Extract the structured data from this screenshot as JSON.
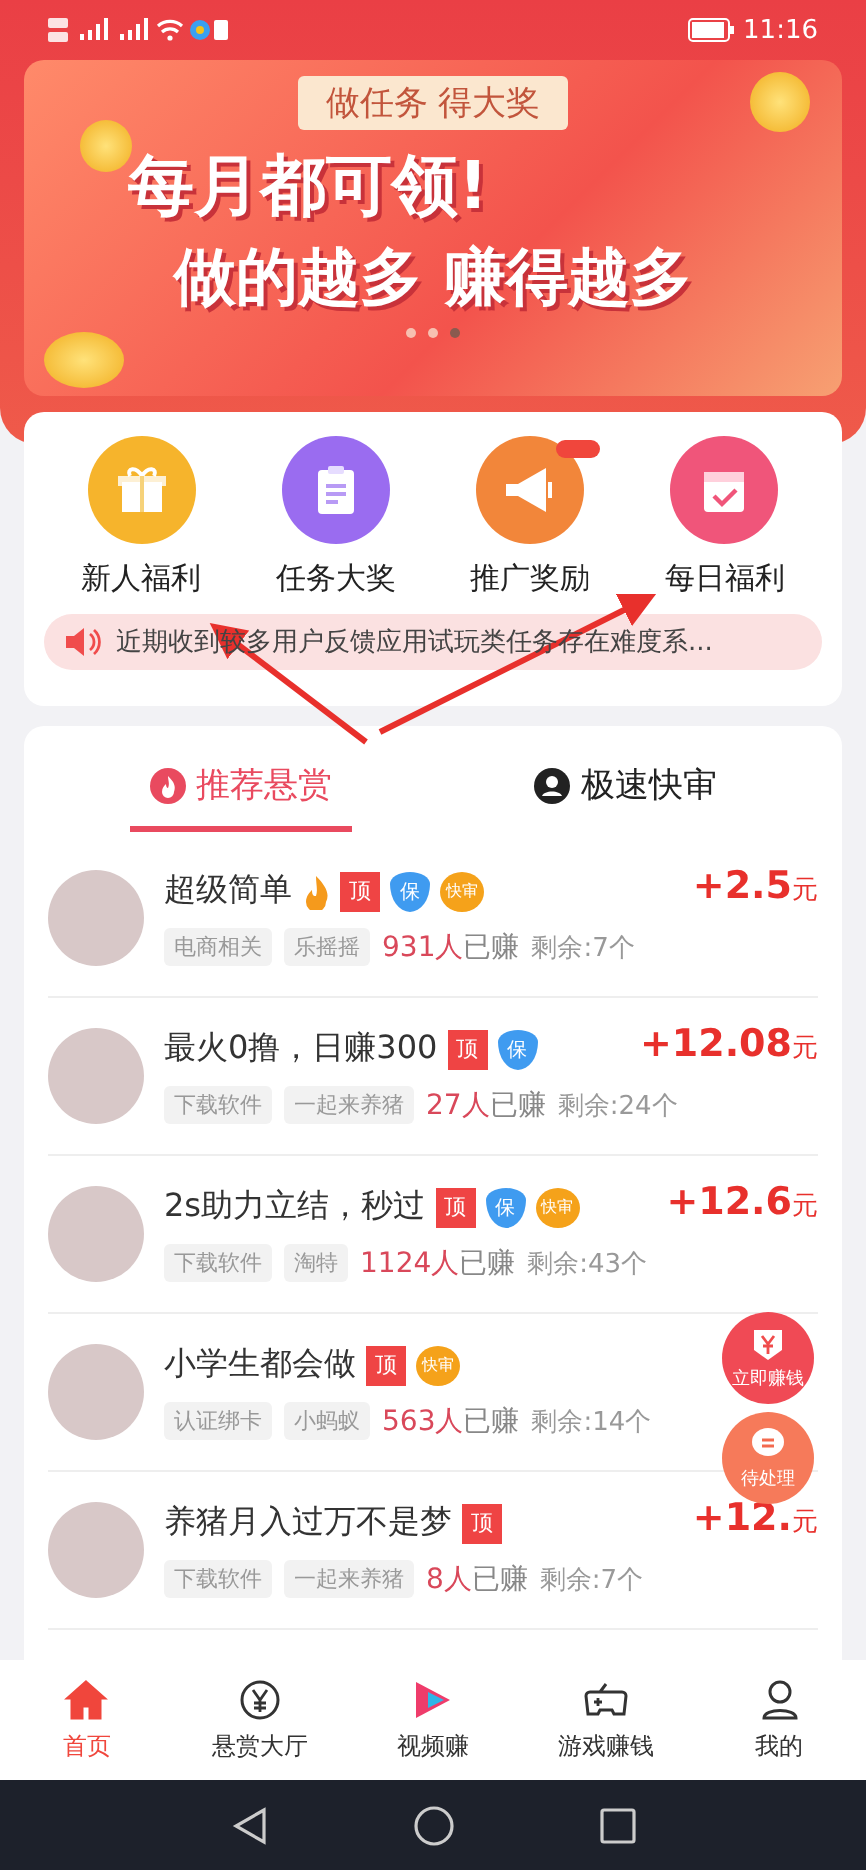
{
  "status_bar": {
    "time": "11:16"
  },
  "banner": {
    "tag": "做任务 得大奖",
    "headline": "每月都可领!",
    "subline": "做的越多 赚得越多",
    "dots": [
      {
        "selected": false
      },
      {
        "selected": false
      },
      {
        "selected": true
      }
    ]
  },
  "shortcuts": [
    {
      "label": "新人福利",
      "kind": "gift",
      "color": "#f6b42c"
    },
    {
      "label": "任务大奖",
      "kind": "clipboard",
      "color": "#9a6cf0"
    },
    {
      "label": "推广奖励",
      "kind": "megaphone",
      "color": "#f2863a",
      "corner_tag": true
    },
    {
      "label": "每日福利",
      "kind": "calendar",
      "color": "#f0557a"
    }
  ],
  "notice": {
    "text": "近期收到较多用户反馈应用试玩类任务存在难度系..."
  },
  "tabs": [
    {
      "label": "推荐悬赏",
      "kind": "fire",
      "selected": true
    },
    {
      "label": "极速快审",
      "kind": "user",
      "selected": false
    }
  ],
  "tasks": [
    {
      "title": "超级简单",
      "fire": true,
      "badges": [
        {
          "kind": "top",
          "text": "顶"
        },
        {
          "kind": "shield",
          "text": "保"
        },
        {
          "kind": "coin",
          "text": "快审"
        }
      ],
      "tags": [
        "电商相关",
        "乐摇摇"
      ],
      "earned": "931人",
      "earned_label": "已赚",
      "remaining": "剩余:7个",
      "price": "+2.5",
      "unit": "元"
    },
    {
      "title": "最火0撸，日赚300",
      "fire": false,
      "badges": [
        {
          "kind": "top",
          "text": "顶"
        },
        {
          "kind": "shield",
          "text": "保"
        }
      ],
      "tags": [
        "下载软件",
        "一起来养猪"
      ],
      "earned": "27人",
      "earned_label": "已赚",
      "remaining": "剩余:24个",
      "price": "+12.08",
      "unit": "元"
    },
    {
      "title": "2s助力立结，秒过",
      "fire": false,
      "badges": [
        {
          "kind": "top",
          "text": "顶"
        },
        {
          "kind": "shield",
          "text": "保"
        },
        {
          "kind": "coin",
          "text": "快审"
        }
      ],
      "tags": [
        "下载软件",
        "淘特"
      ],
      "earned": "1124人",
      "earned_label": "已赚",
      "remaining": "剩余:43个",
      "price": "+12.6",
      "unit": "元"
    },
    {
      "title": "小学生都会做",
      "fire": false,
      "badges": [
        {
          "kind": "top",
          "text": "顶"
        },
        {
          "kind": "coin",
          "text": "快审"
        }
      ],
      "tags": [
        "认证绑卡",
        "小蚂蚁"
      ],
      "earned": "563人",
      "earned_label": "已赚",
      "remaining": "剩余:14个"
    },
    {
      "title": "养猪月入过万不是梦",
      "fire": false,
      "badges": [
        {
          "kind": "top",
          "text": "顶"
        }
      ],
      "tags": [
        "下载软件",
        "一起来养猪"
      ],
      "earned": "8人",
      "earned_label": "已赚",
      "remaining": "剩余:7个",
      "price": "+12.",
      "unit": "元"
    }
  ],
  "floating_buttons": [
    {
      "label": "立即赚钱",
      "kind": "yen"
    },
    {
      "label": "待处理",
      "kind": "chat"
    }
  ],
  "nav": [
    {
      "label": "首页",
      "kind": "home",
      "selected": true
    },
    {
      "label": "悬赏大厅",
      "kind": "yen",
      "selected": false
    },
    {
      "label": "视频赚",
      "kind": "play",
      "selected": false
    },
    {
      "label": "游戏赚钱",
      "kind": "game",
      "selected": false
    },
    {
      "label": "我的",
      "kind": "user",
      "selected": false
    }
  ]
}
